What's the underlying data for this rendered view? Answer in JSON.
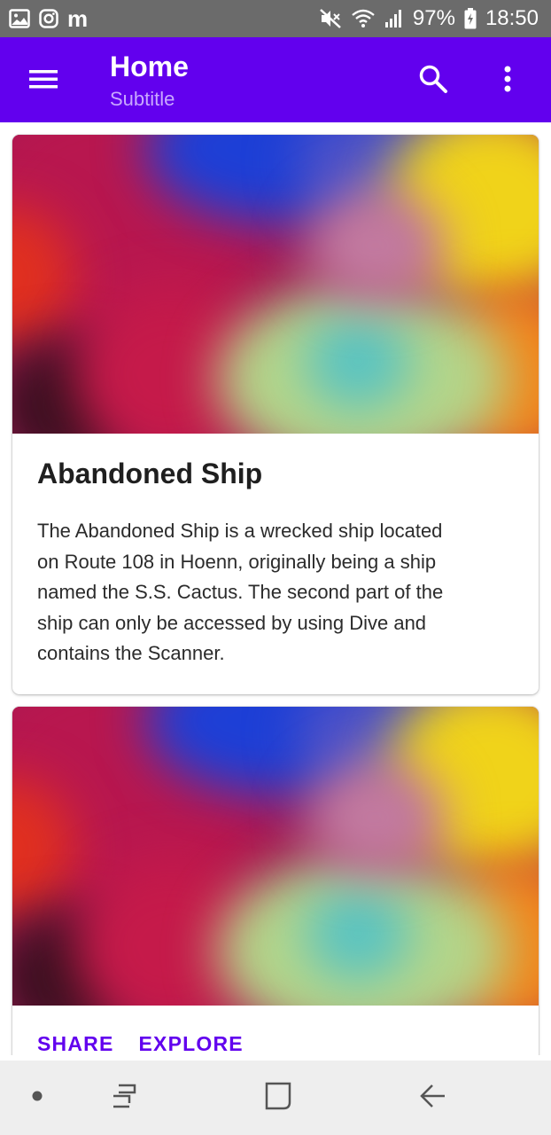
{
  "status_bar": {
    "battery": "97%",
    "time": "18:50",
    "left_text": "m",
    "icons": [
      "image-icon",
      "instagram-icon",
      "mute-icon",
      "wifi-icon",
      "signal-icon",
      "battery-charging-icon"
    ]
  },
  "app_bar": {
    "title": "Home",
    "subtitle": "Subtitle",
    "background_color": "#6200ee",
    "icons": [
      "menu-icon",
      "search-icon",
      "more-vertical-icon"
    ]
  },
  "cards": [
    {
      "title": "Abandoned Ship",
      "body_lines": [
        "The Abandoned Ship is a wrecked ship located",
        "on Route 108 in Hoenn, originally being a ship",
        "named the S.S. Cactus. The second part of the",
        "ship can only be accessed by using Dive and",
        "contains the Scanner."
      ]
    },
    {
      "actions": [
        "SHARE",
        "EXPLORE"
      ]
    }
  ],
  "nav_bar": {
    "icons": [
      "dot-icon",
      "recent-apps-icon",
      "home-icon",
      "back-icon"
    ]
  },
  "colors": {
    "accent": "#6200ee",
    "subtitle": "#c9a8ff",
    "status_bar": "#6b6b6b"
  }
}
